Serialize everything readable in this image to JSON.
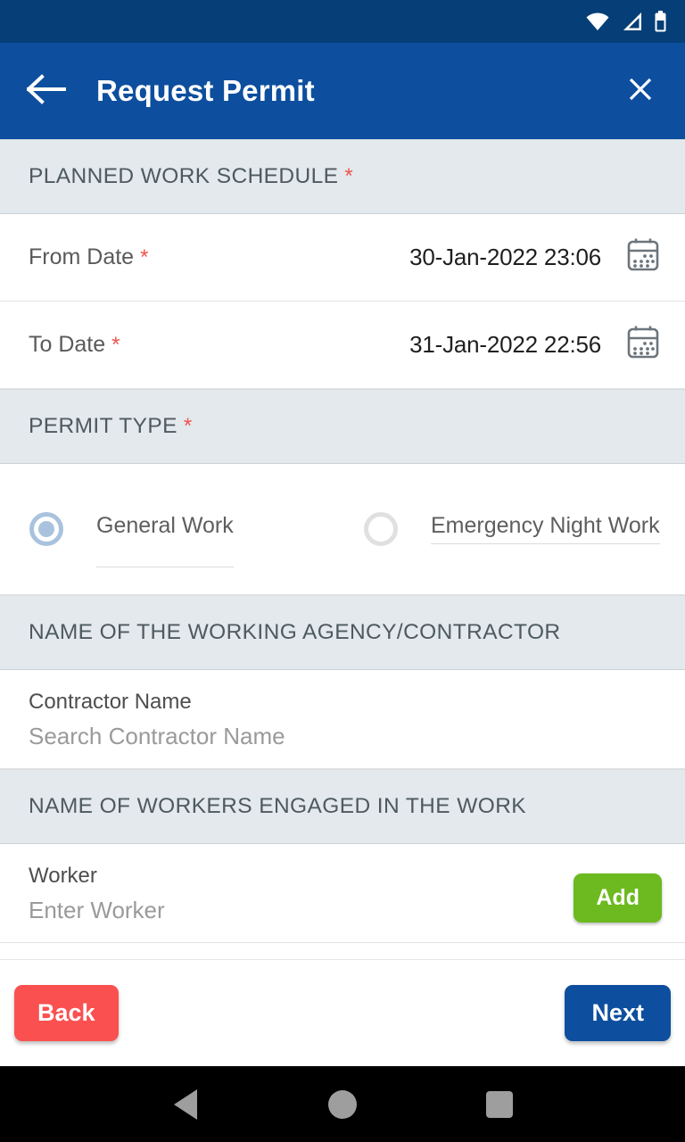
{
  "status_bar": {
    "icons": [
      "wifi-icon",
      "signal-icon",
      "battery-icon"
    ],
    "background": "#063f77"
  },
  "app_bar": {
    "title": "Request Permit",
    "back_icon": "arrow-left-icon",
    "close_icon": "close-icon",
    "background": "#0d4f9e"
  },
  "sections": {
    "schedule": {
      "title": "PLANNED WORK SCHEDULE",
      "required_mark": "*",
      "from_date": {
        "label": "From Date",
        "required_mark": "*",
        "value": "30-Jan-2022 23:06",
        "icon": "calendar-icon"
      },
      "to_date": {
        "label": "To Date",
        "required_mark": "*",
        "value": "31-Jan-2022 22:56",
        "icon": "calendar-icon"
      }
    },
    "permit_type": {
      "title": "PERMIT TYPE",
      "required_mark": "*",
      "options": [
        {
          "label": "General Work",
          "selected": true
        },
        {
          "label": "Emergency Night Work",
          "selected": false
        }
      ]
    },
    "contractor": {
      "title": "NAME OF THE WORKING AGENCY/CONTRACTOR",
      "field_label": "Contractor Name",
      "placeholder": "Search Contractor Name",
      "value": ""
    },
    "workers": {
      "title": "NAME OF WORKERS ENGAGED IN THE WORK",
      "field_label": "Worker",
      "placeholder": "Enter Worker",
      "value": "",
      "add_label": "Add"
    }
  },
  "footer": {
    "back_label": "Back",
    "next_label": "Next"
  },
  "nav_bar": {
    "back_icon": "nav-back-triangle-icon",
    "home_icon": "nav-home-circle-icon",
    "recents_icon": "nav-recents-square-icon"
  },
  "colors": {
    "primary": "#0d4f9e",
    "status_bar": "#063f77",
    "section_header": "#e3e9ec",
    "accent_green": "#6cba1f",
    "accent_red": "#fa5050",
    "required_red": "#ef5350",
    "radio_selected": "#a9c3de"
  }
}
